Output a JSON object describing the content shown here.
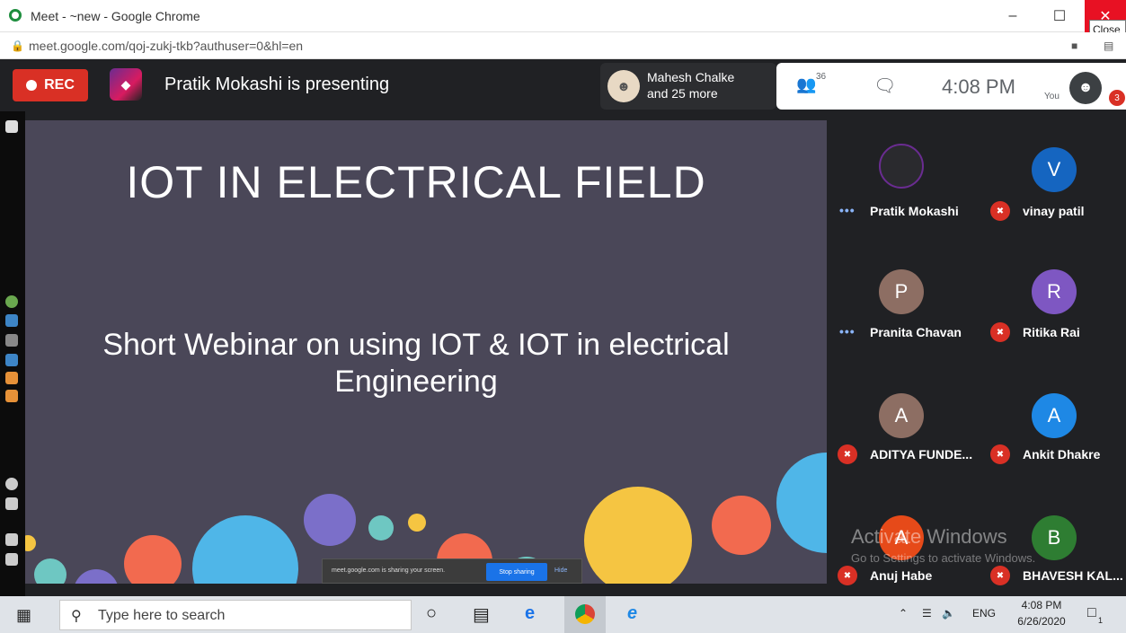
{
  "browser": {
    "window_title": "Meet - ~new - Google Chrome",
    "url": "meet.google.com/qoj-zukj-tkb?authuser=0&hl=en",
    "close_tooltip": "Close",
    "minimize": "–",
    "maximize": "☐",
    "close": "✕"
  },
  "meet": {
    "rec_label": "REC",
    "presenting": "Pratik Mokashi is presenting",
    "people_chip": {
      "line1": "Mahesh Chalke",
      "line2": "and 25 more"
    },
    "participant_count": "36",
    "clock": "4:08 PM",
    "you_label": "You",
    "notification_badge": "3"
  },
  "slide": {
    "title": "IOT IN ELECTRICAL FIELD",
    "subtitle_line1": "Short Webinar on using IOT & IOT in electrical",
    "subtitle_line2": "Engineering",
    "share_banner": {
      "message": "meet.google.com is sharing your screen.",
      "stop": "Stop sharing",
      "hide": "Hide"
    }
  },
  "participants": [
    {
      "name": "Pratik Mokashi",
      "initial": "",
      "color": "#2a2a2e",
      "status": "speaking"
    },
    {
      "name": "vinay patil",
      "initial": "V",
      "color": "#1565c0",
      "status": "muted"
    },
    {
      "name": "Pranita Chavan",
      "initial": "P",
      "color": "#8d6e63",
      "status": "speaking"
    },
    {
      "name": "Ritika Rai",
      "initial": "R",
      "color": "#7e57c2",
      "status": "muted"
    },
    {
      "name": "ADITYA FUNDE...",
      "initial": "A",
      "color": "#8d6e63",
      "status": "muted"
    },
    {
      "name": "Ankit Dhakre",
      "initial": "A",
      "color": "#1e88e5",
      "status": "muted"
    },
    {
      "name": "Anuj Habe",
      "initial": "A",
      "color": "#e64a19",
      "status": "muted"
    },
    {
      "name": "BHAVESH KAL...",
      "initial": "B",
      "color": "#2e7d32",
      "status": "muted"
    }
  ],
  "watermark": {
    "line1": "Activate Windows",
    "line2": "Go to Settings to activate Windows."
  },
  "taskbar": {
    "search_placeholder": "Type here to search",
    "lang": "ENG",
    "time": "4:08 PM",
    "date": "6/26/2020",
    "notifications": "1"
  },
  "icons": {
    "start": "windows-start-icon",
    "search": "search-icon",
    "cortana": "cortana-icon",
    "task_view": "task-view-icon",
    "edge": "edge-icon",
    "chrome": "chrome-icon",
    "ie": "internet-explorer-icon"
  },
  "colors": {
    "rec": "#d93025",
    "slide_bg": "#4a4758",
    "meet_bg": "#202124",
    "stop_button": "#1a73e8"
  }
}
